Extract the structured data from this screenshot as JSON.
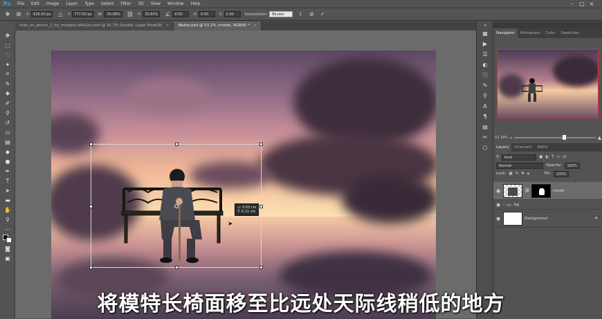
{
  "app": {
    "logo": "Ps"
  },
  "menu": [
    "File",
    "Edit",
    "Image",
    "Layer",
    "Type",
    "Select",
    "Filter",
    "3D",
    "View",
    "Window",
    "Help"
  ],
  "options": {
    "x_label": "X:",
    "x_value": "626.50 px",
    "y_label": "Y:",
    "y_value": "777.50 px",
    "w_label": "W:",
    "w_value": "-35.68%",
    "h_label": "H:",
    "h_value": "35.65%",
    "angle_value": "0.00",
    "hskew_label": "H:",
    "hskew_value": "0.00",
    "vskew_label": "V:",
    "vskew_value": "0.00",
    "interp_label": "Interpolation:",
    "interp_value": "Bicubic"
  },
  "tabs": [
    {
      "label": "man_on_bench_2_by_mleighs-d4lu2ev.psd @ 35.7% (model, Layer Mask/8)",
      "close": "×"
    },
    {
      "label": "Waiter.psd @ 53.2% (model, RGB/8) *",
      "close": "×"
    }
  ],
  "transform_tip": {
    "line1": "◁: 0.03 cm",
    "line2": "T: 0.11 cm"
  },
  "subtitle": "将模特长椅面移至比远处天际线稍低的地方",
  "panel": {
    "tabs": [
      "Navigator",
      "Histogram",
      "Color",
      "Swatches"
    ],
    "zoom": "53.18%",
    "layer_tabs": [
      "Layers",
      "Channels",
      "Paths"
    ],
    "kind": "Kind",
    "blend": "Normal",
    "opacity_label": "Opacity:",
    "opacity_value": "100%",
    "lock_label": "Lock:",
    "fill_label": "Fill:",
    "fill_value": "100%",
    "layers": [
      {
        "name": "model"
      },
      {
        "name": "bg"
      },
      {
        "name": "Background"
      }
    ]
  },
  "colors": {
    "accent": "#2fa3f7",
    "nav_frame": "#e22233"
  }
}
